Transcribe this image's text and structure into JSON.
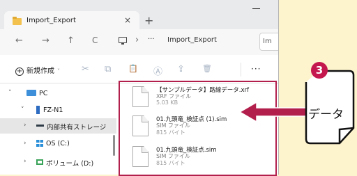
{
  "window": {
    "tab_title": "Import_Export",
    "tab_close": "×",
    "new_tab": "+"
  },
  "address": {
    "back": "←",
    "forward": "→",
    "up": "↑",
    "refresh": "C",
    "chevron": "›",
    "more": "···",
    "path": "Import_Export",
    "search_prefix": "Im"
  },
  "toolbar": {
    "new_label": "新規作成",
    "new_chevron": "˅",
    "cut": "✂",
    "copy": "⧉",
    "paste": "📋",
    "rename": "Ⓐ",
    "share": "⇪",
    "delete": "🗑",
    "more": "···"
  },
  "nav": {
    "items": [
      {
        "chevron": "˅",
        "label": "PC"
      },
      {
        "chevron": "˅",
        "label": "FZ-N1"
      },
      {
        "chevron": "›",
        "label": "内部共有ストレージ"
      },
      {
        "chevron": "›",
        "label": "OS (C:)"
      },
      {
        "chevron": "›",
        "label": "ボリューム (D:)"
      }
    ]
  },
  "files": [
    {
      "name": "【サンプルデータ】路線データ.xrf",
      "type": "XRF ファイル",
      "size": "5.03 KB"
    },
    {
      "name": "01.九頭竜_検証点 (1).sim",
      "type": "SIM ファイル",
      "size": "815 バイト"
    },
    {
      "name": "01.九頭竜_検証点.sim",
      "type": "SIM ファイル",
      "size": "815 バイト"
    }
  ],
  "annotation": {
    "step_number": "3",
    "label": "データ",
    "accent": "#c4174d",
    "highlight": "#b21f4d",
    "background": "#fdf3cc"
  }
}
